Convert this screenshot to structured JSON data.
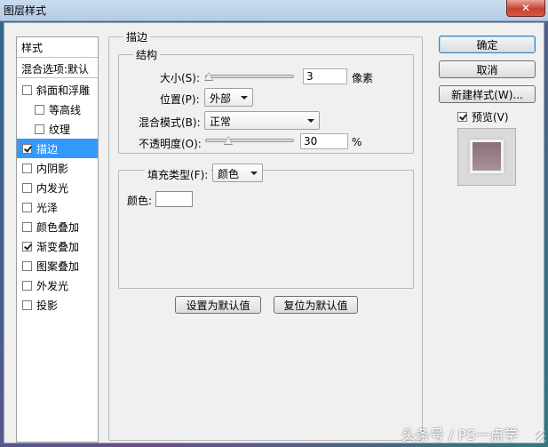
{
  "window": {
    "title": "图层样式",
    "close_glyph": "✕"
  },
  "style_list": {
    "header": "样式",
    "blend_options": "混合选项:默认",
    "items": [
      {
        "label": "斜面和浮雕",
        "checked": false,
        "sub": false,
        "selected": false
      },
      {
        "label": "等高线",
        "checked": false,
        "sub": true,
        "selected": false
      },
      {
        "label": "纹理",
        "checked": false,
        "sub": true,
        "selected": false
      },
      {
        "label": "描边",
        "checked": true,
        "sub": false,
        "selected": true
      },
      {
        "label": "内阴影",
        "checked": false,
        "sub": false,
        "selected": false
      },
      {
        "label": "内发光",
        "checked": false,
        "sub": false,
        "selected": false
      },
      {
        "label": "光泽",
        "checked": false,
        "sub": false,
        "selected": false
      },
      {
        "label": "颜色叠加",
        "checked": false,
        "sub": false,
        "selected": false
      },
      {
        "label": "渐变叠加",
        "checked": true,
        "sub": false,
        "selected": false
      },
      {
        "label": "图案叠加",
        "checked": false,
        "sub": false,
        "selected": false
      },
      {
        "label": "外发光",
        "checked": false,
        "sub": false,
        "selected": false
      },
      {
        "label": "投影",
        "checked": false,
        "sub": false,
        "selected": false
      }
    ]
  },
  "stroke": {
    "title": "描边",
    "structure": {
      "title": "结构",
      "size_label": "大小(S):",
      "size_value": "3",
      "size_unit": "像素",
      "position_label": "位置(P):",
      "position_value": "外部",
      "blend_label": "混合模式(B):",
      "blend_value": "正常",
      "opacity_label": "不透明度(O):",
      "opacity_value": "30",
      "opacity_unit": "%"
    },
    "fill": {
      "type_label": "填充类型(F):",
      "type_value": "颜色",
      "color_label": "颜色:",
      "color_hex": "#ffffff"
    },
    "set_default": "设置为默认值",
    "reset_default": "复位为默认值"
  },
  "buttons": {
    "ok": "确定",
    "cancel": "取消",
    "new_style": "新建样式(W)...",
    "preview_label": "预览(V)",
    "preview_checked": true
  },
  "watermark": "头条号 / PS一点学",
  "colors": {
    "selection": "#3399ff",
    "close_button": "#c7422f"
  }
}
